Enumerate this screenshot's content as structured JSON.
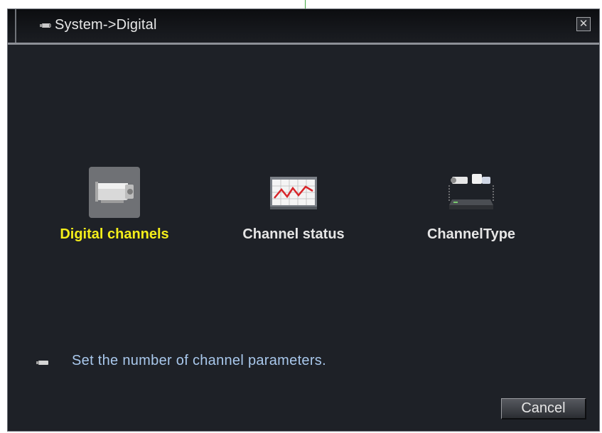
{
  "window": {
    "title": "System->Digital",
    "close_label": "✕"
  },
  "tiles": [
    {
      "label": "Digital channels",
      "icon": "camera-icon",
      "selected": true
    },
    {
      "label": "Channel status",
      "icon": "line-chart-icon",
      "selected": false
    },
    {
      "label": "ChannelType",
      "icon": "camera-dvr-icon",
      "selected": false
    }
  ],
  "tip": {
    "text": "Set the number of channel parameters."
  },
  "buttons": {
    "cancel_label": "Cancel"
  },
  "colors": {
    "background": "#1e2127",
    "selected_label": "#f4ee1a",
    "label": "#e6e6e6",
    "tip_text": "#a9c8ec",
    "selection_box": "#6f7175"
  }
}
